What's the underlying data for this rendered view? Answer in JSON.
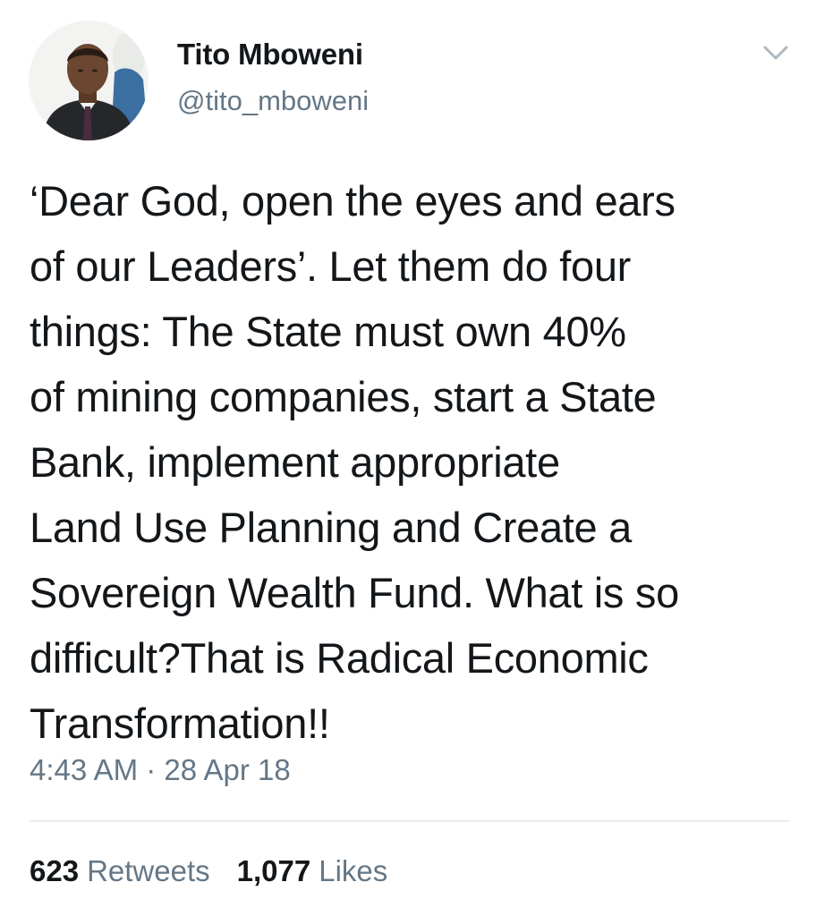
{
  "author": {
    "display_name": "Tito Mboweni",
    "handle": "@tito_mboweni"
  },
  "tweet": {
    "text": "‘Dear God, open the eyes and ears\nof our Leaders’. Let them do four\nthings: The State must own 40%\nof mining companies, start a State\nBank, implement appropriate\nLand Use Planning and Create a\nSovereign Wealth Fund. What is so\ndifficult?That is Radical Economic\nTransformation!!",
    "timestamp": "4:43 AM · 28 Apr 18"
  },
  "stats": {
    "retweets_count": "623",
    "retweets_label": "Retweets",
    "likes_count": "1,077",
    "likes_label": "Likes"
  },
  "icons": {
    "menu": "chevron-down-icon",
    "avatar": "profile-photo"
  },
  "colors": {
    "text": "#14171a",
    "secondary": "#657786",
    "divider": "#e6ecf0",
    "caret": "#aab8c2"
  }
}
